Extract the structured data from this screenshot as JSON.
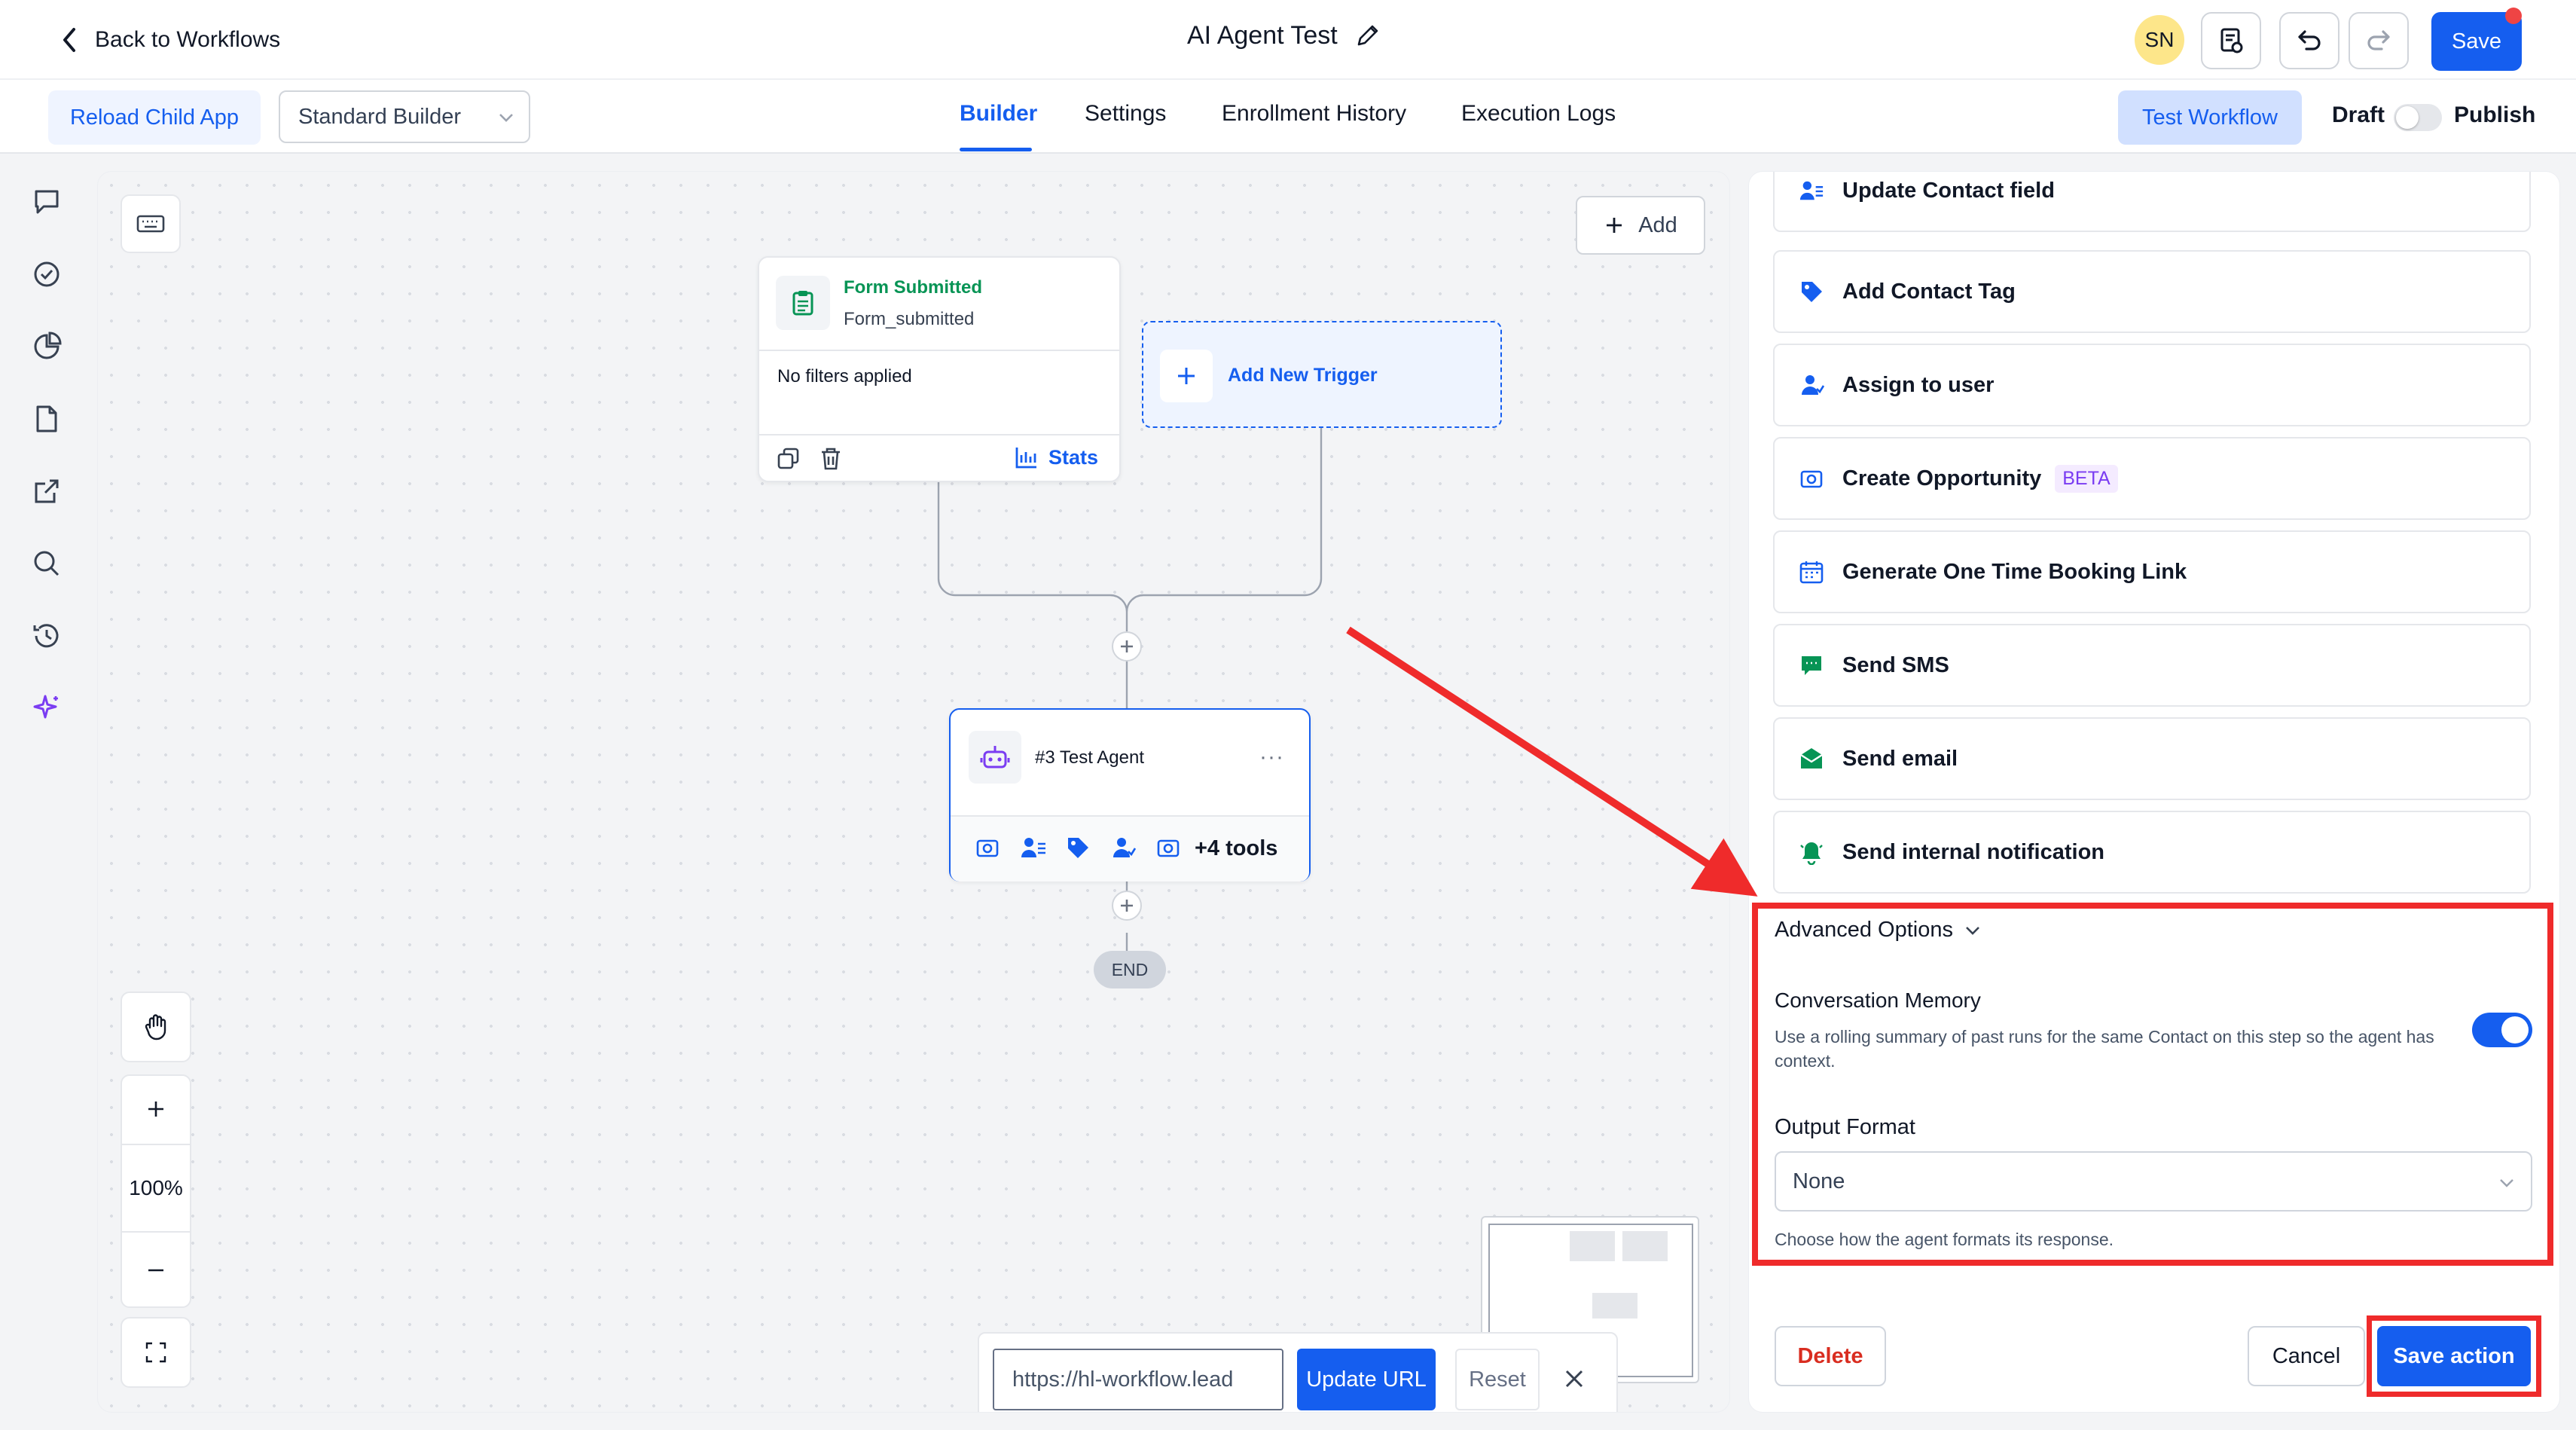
{
  "header": {
    "back_label": "Back to Workflows",
    "workflow_title": "AI Agent Test",
    "avatar_initials": "SN",
    "save_label": "Save"
  },
  "subheader": {
    "reload_label": "Reload Child App",
    "builder_select": "Standard Builder",
    "tabs": [
      {
        "label": "Builder",
        "active": true
      },
      {
        "label": "Settings",
        "active": false
      },
      {
        "label": "Enrollment History",
        "active": false
      },
      {
        "label": "Execution Logs",
        "active": false
      }
    ],
    "test_workflow_label": "Test Workflow",
    "draft_label": "Draft",
    "publish_label": "Publish",
    "publish_toggle_on": false
  },
  "rail_icons": [
    "chat-icon",
    "check-circle-icon",
    "pie-chart-icon",
    "file-icon",
    "external-link-icon",
    "search-icon",
    "history-icon",
    "sparkle-icon"
  ],
  "canvas": {
    "add_label": "Add",
    "trigger": {
      "title": "Form Submitted",
      "subtitle": "Form_submitted",
      "filters": "No filters applied",
      "stats_label": "Stats"
    },
    "add_trigger_label": "Add New Trigger",
    "agent": {
      "name": "#3 Test Agent",
      "tools_more": "+4 tools"
    },
    "end_label": "END",
    "zoom_level": "100%",
    "url_value": "https://hl-workflow.lead",
    "update_url_label": "Update URL",
    "reset_label": "Reset"
  },
  "panel": {
    "actions": [
      {
        "label": "Update Contact field",
        "icon": "contact-field-icon",
        "badge": ""
      },
      {
        "label": "Add Contact Tag",
        "icon": "tag-icon",
        "badge": ""
      },
      {
        "label": "Assign to user",
        "icon": "assign-user-icon",
        "badge": ""
      },
      {
        "label": "Create Opportunity",
        "icon": "opportunity-icon",
        "badge": "BETA"
      },
      {
        "label": "Generate One Time Booking Link",
        "icon": "calendar-icon",
        "badge": ""
      },
      {
        "label": "Send SMS",
        "icon": "sms-icon",
        "badge": ""
      },
      {
        "label": "Send email",
        "icon": "email-icon",
        "badge": ""
      },
      {
        "label": "Send internal notification",
        "icon": "bell-icon",
        "badge": ""
      }
    ],
    "advanced_label": "Advanced Options",
    "memory_title": "Conversation Memory",
    "memory_desc": "Use a rolling summary of past runs for the same Contact on this step so the agent has context.",
    "memory_enabled": true,
    "output_label": "Output Format",
    "output_value": "None",
    "output_help": "Choose how the agent formats its response.",
    "delete_label": "Delete",
    "cancel_label": "Cancel",
    "save_action_label": "Save action"
  },
  "colors": {
    "primary": "#155eef",
    "highlight_red": "#ef2b2b",
    "green": "#079455",
    "purple": "#7a3cf2",
    "delete_red": "#d92d20"
  }
}
